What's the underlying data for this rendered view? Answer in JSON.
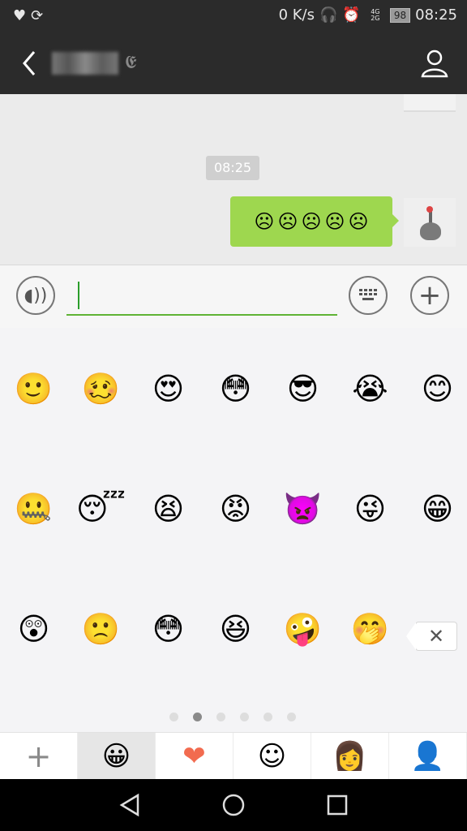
{
  "status_bar": {
    "left_icons": [
      "heart-pulse-icon",
      "sync-icon"
    ],
    "speed": "0 K/s",
    "signal_labels": [
      "4G",
      "2G"
    ],
    "battery": "98",
    "time": "08:25"
  },
  "header": {
    "title": "",
    "icons": {
      "back": "back-icon",
      "profile": "person-icon",
      "ear": "ear-icon"
    }
  },
  "chat": {
    "timestamp": "08:25",
    "message_emojis": [
      "☹",
      "☹",
      "☹",
      "☹",
      "☹"
    ]
  },
  "input": {
    "value": "",
    "placeholder": ""
  },
  "emoji_panel": {
    "rows": [
      [
        "🙂",
        "🥴",
        "😍",
        "😳",
        "😎",
        "😭",
        "😊"
      ],
      [
        "🤐",
        "😴",
        "😫",
        "😡",
        "👿",
        "😜",
        "😁"
      ],
      [
        "😲",
        "🙁",
        "😳",
        "😆",
        "🤪",
        "🤭"
      ]
    ],
    "delete_label": "✕",
    "page_dots": 6,
    "active_page": 1
  },
  "tabs": [
    {
      "label": "+",
      "selected": false
    },
    {
      "label": "😀",
      "selected": true
    },
    {
      "label": "❤",
      "selected": false
    },
    {
      "label": "☺",
      "selected": false
    },
    {
      "label": "👩",
      "selected": false
    },
    {
      "label": "👤",
      "selected": false
    }
  ],
  "colors": {
    "bubble": "#9ed74f",
    "accent": "#5fb335",
    "header": "#2b2b2b"
  }
}
